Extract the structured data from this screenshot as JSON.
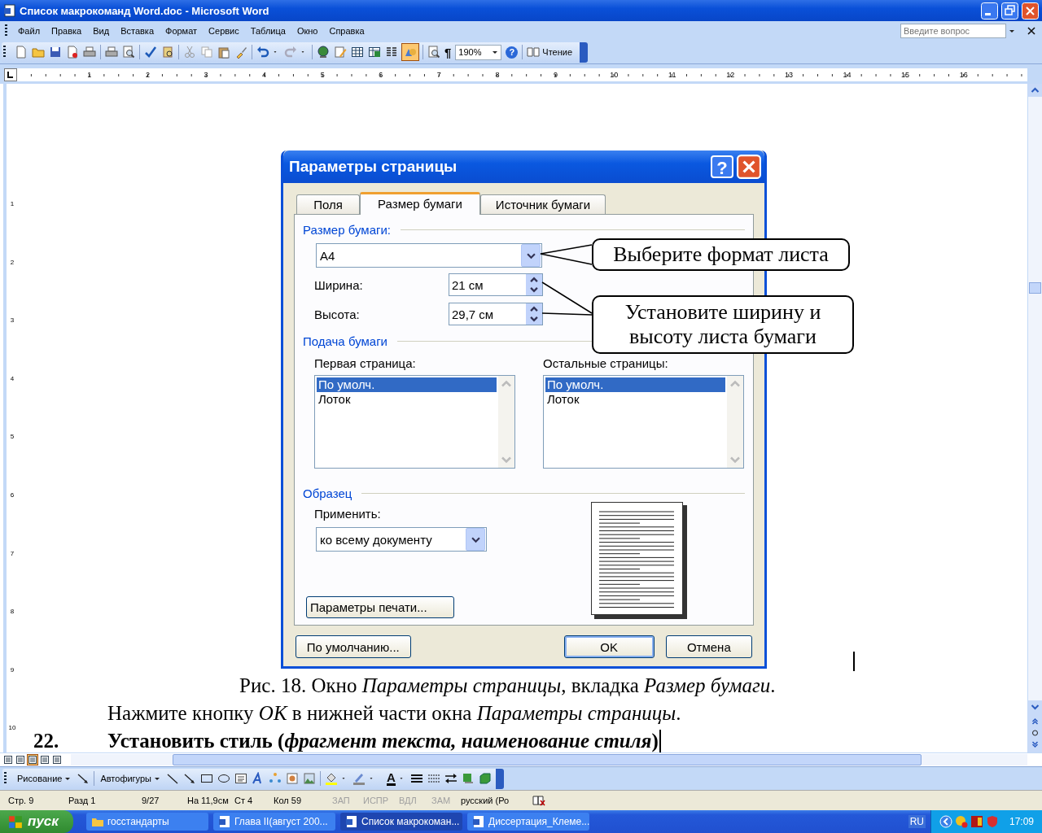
{
  "window": {
    "title": "Список макрокоманд Word.doc - Microsoft Word"
  },
  "menu": [
    "Файл",
    "Правка",
    "Вид",
    "Вставка",
    "Формат",
    "Сервис",
    "Таблица",
    "Окно",
    "Справка"
  ],
  "help_search": {
    "placeholder": "Введите вопрос"
  },
  "toolbar": {
    "pilcrow": "¶",
    "zoom": "190%",
    "help": "?",
    "reading_button": "Чтение"
  },
  "ruler": {
    "marks": [
      "1",
      "2",
      "3",
      "4",
      "5",
      "6",
      "7",
      "8",
      "9",
      "10",
      "11",
      "12",
      "13",
      "14",
      "15",
      "16"
    ]
  },
  "vertical_ruler": {
    "marks": [
      "1",
      "2",
      "3",
      "4",
      "5",
      "6",
      "7",
      "8",
      "9",
      "10"
    ]
  },
  "dialog": {
    "title": "Параметры страницы",
    "help_button": "?",
    "tabs": [
      {
        "label": "Поля",
        "selected": false
      },
      {
        "label": "Размер бумаги",
        "selected": true
      },
      {
        "label": "Источник бумаги",
        "selected": false
      }
    ],
    "paper_size": {
      "heading": "Размер бумаги:",
      "format": "A4",
      "width_label": "Ширина:",
      "width": "21 см",
      "height_label": "Высота:",
      "height": "29,7 см"
    },
    "paper_source": {
      "heading": "Подача бумаги",
      "first_page": {
        "label": "Первая страница:",
        "items": [
          {
            "text": "По умолч.",
            "selected": true
          },
          {
            "text": "Лоток",
            "selected": false
          }
        ]
      },
      "other_pages": {
        "label": "Остальные страницы:",
        "items": [
          {
            "text": "По умолч.",
            "selected": true
          },
          {
            "text": "Лоток",
            "selected": false
          }
        ]
      }
    },
    "preview": {
      "heading": "Образец",
      "apply_label": "Применить:",
      "apply_to": "ко всему документу",
      "print_options_button": "Параметры печати..."
    },
    "buttons": {
      "default": "По умолчанию...",
      "ok": "OK",
      "cancel": "Отмена"
    }
  },
  "callouts": [
    {
      "text": "Выберите формат листа"
    },
    {
      "text": "Установите ширину и высоту листа бумаги"
    }
  ],
  "document": {
    "caption": "Рис. 18. Окно *Параметры страницы*, вкладка *Размер бумаги*.",
    "instruction": "Нажмите кнопку *OK* в нижней части окна *Параметры страницы*.",
    "step": {
      "number": "22.",
      "text": "Установить стиль (*фрагмент текста, наименование стиля*)"
    }
  },
  "drawing_toolbar": {
    "draw_menu": "Рисование",
    "autoshapes": "Автофигуры",
    "font_color": "A"
  },
  "status_bar": [
    {
      "text": "Стр. 9",
      "disabled": false
    },
    {
      "text": "Разд 1",
      "disabled": false
    },
    {
      "text": "9/27",
      "disabled": false
    },
    {
      "text": "На 11,9см",
      "disabled": false
    },
    {
      "text": "Ст 4",
      "disabled": false
    },
    {
      "text": "Кол 59",
      "disabled": false
    },
    {
      "text": "ЗАП",
      "disabled": true
    },
    {
      "text": "ИСПР",
      "disabled": true
    },
    {
      "text": "ВДЛ",
      "disabled": true
    },
    {
      "text": "ЗАМ",
      "disabled": true
    },
    {
      "text": "русский (Ро",
      "disabled": false
    }
  ],
  "taskbar": {
    "start": "пуск",
    "tasks": [
      {
        "label": "госстандарты",
        "kind": "folder",
        "selected": false
      },
      {
        "label": "Глава II(август 200...",
        "kind": "document",
        "selected": false
      },
      {
        "label": "Список макрокоман...",
        "kind": "document",
        "selected": true
      },
      {
        "label": "Диссертация_Клеме...",
        "kind": "document",
        "selected": false
      }
    ],
    "language": "RU",
    "clock": "17:09"
  }
}
